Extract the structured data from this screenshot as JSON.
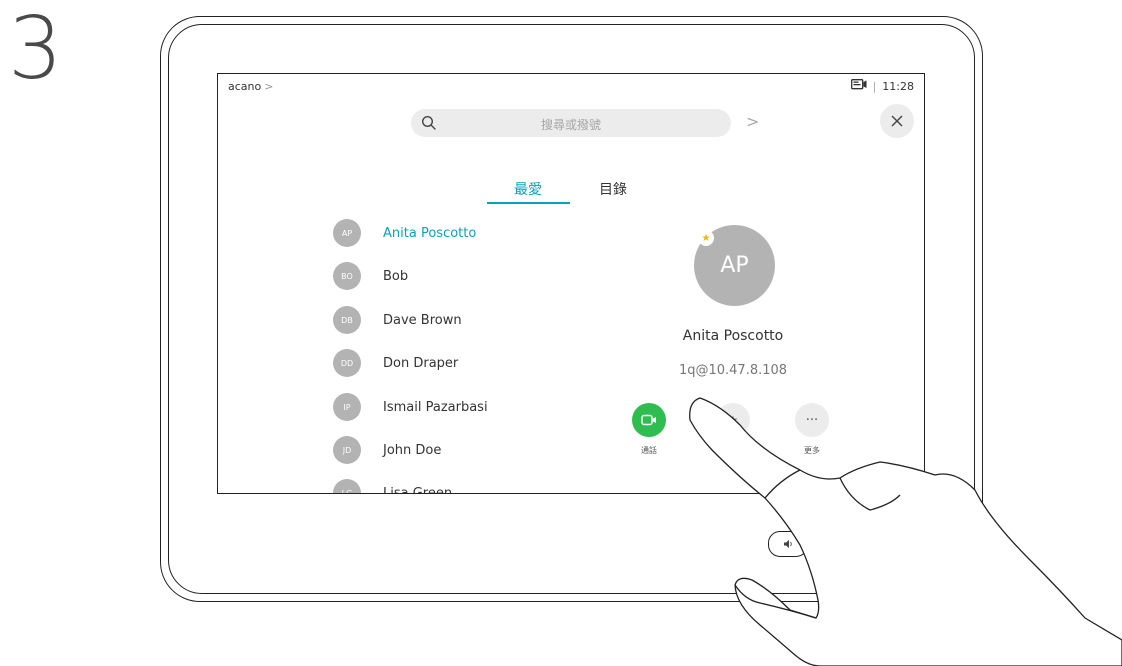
{
  "step": "3",
  "status": {
    "breadcrumb": "acano",
    "breadcrumb_chevron": ">",
    "separator": "|",
    "time": "11:28"
  },
  "search": {
    "placeholder": "搜尋或撥號",
    "forward_chevron": ">"
  },
  "tabs": [
    {
      "label": "最愛"
    },
    {
      "label": "目錄"
    }
  ],
  "contacts": [
    {
      "initials": "AP",
      "name": "Anita Poscotto"
    },
    {
      "initials": "BO",
      "name": "Bob"
    },
    {
      "initials": "DB",
      "name": "Dave Brown"
    },
    {
      "initials": "DD",
      "name": "Don Draper"
    },
    {
      "initials": "IP",
      "name": "Ismail Pazarbasi"
    },
    {
      "initials": "JD",
      "name": "John Doe"
    },
    {
      "initials": "LG",
      "name": "Lisa Green"
    }
  ],
  "detail": {
    "initials": "AP",
    "name": "Anita Poscotto",
    "address": "1q@10.47.8.108"
  },
  "actions": {
    "call_label": "通話",
    "more_label": "更多",
    "more_glyph": "···"
  },
  "colors": {
    "accent": "#0aa2c0",
    "call_green": "#2fbd4f",
    "avatar_gray": "#b3b3b3",
    "star_yellow": "#f2b705"
  },
  "icons": {
    "status": "screen-share-icon",
    "search": "search-icon",
    "close": "close-icon",
    "call": "video-call-icon",
    "favorite": "star-icon",
    "more": "more-icon",
    "volume": "volume-icon"
  }
}
